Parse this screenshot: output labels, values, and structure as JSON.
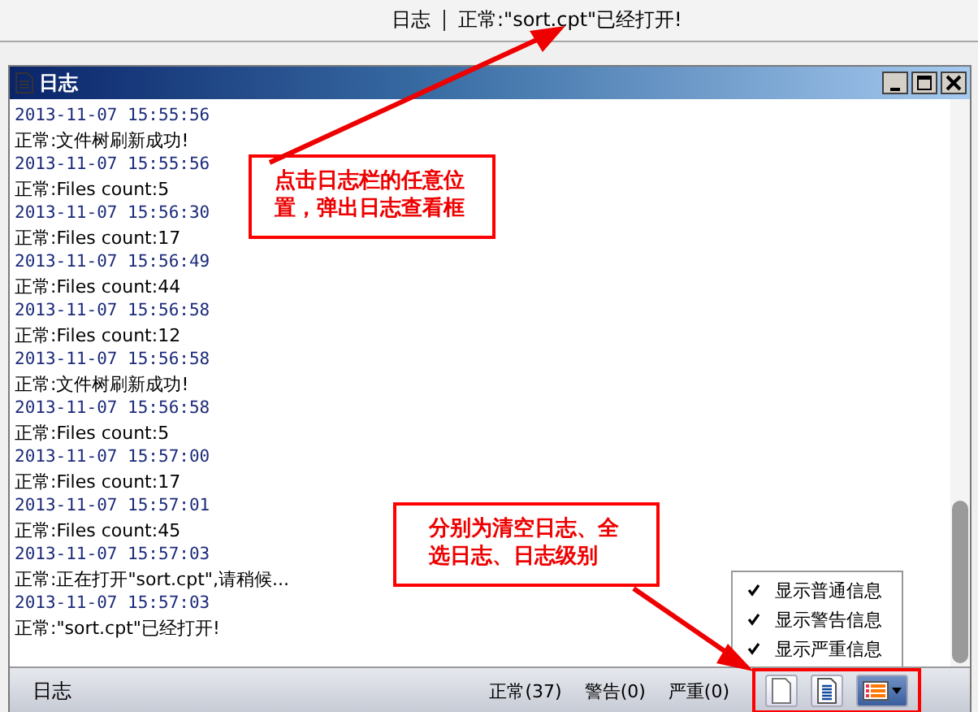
{
  "top_bar": {
    "label": "日志",
    "message": "正常:\"sort.cpt\"已经打开!"
  },
  "window": {
    "title": "日志"
  },
  "log": [
    {
      "time": "2013-11-07 15:55:56",
      "message": "正常:文件树刷新成功!"
    },
    {
      "time": "2013-11-07 15:55:56",
      "message": "正常:Files count:5"
    },
    {
      "time": "2013-11-07 15:56:30",
      "message": "正常:Files count:17"
    },
    {
      "time": "2013-11-07 15:56:49",
      "message": "正常:Files count:44"
    },
    {
      "time": "2013-11-07 15:56:58",
      "message": "正常:Files count:12"
    },
    {
      "time": "2013-11-07 15:56:58",
      "message": "正常:文件树刷新成功!"
    },
    {
      "time": "2013-11-07 15:56:58",
      "message": "正常:Files count:5"
    },
    {
      "time": "2013-11-07 15:57:00",
      "message": "正常:Files count:17"
    },
    {
      "time": "2013-11-07 15:57:01",
      "message": "正常:Files count:45"
    },
    {
      "time": "2013-11-07 15:57:03",
      "message": "正常:正在打开\"sort.cpt\",请稍候..."
    },
    {
      "time": "2013-11-07 15:57:03",
      "message": "正常:\"sort.cpt\"已经打开!"
    }
  ],
  "status_bar": {
    "label": "日志",
    "counts": [
      "正常(37)",
      "警告(0)",
      "严重(0)"
    ]
  },
  "level_menu": [
    {
      "label": "显示普通信息",
      "checked": true
    },
    {
      "label": "显示警告信息",
      "checked": true
    },
    {
      "label": "显示严重信息",
      "checked": true
    }
  ],
  "callouts": [
    "点击日志栏的任意位置，弹出日志查看框",
    "分别为清空日志、全选日志、日志级别"
  ]
}
